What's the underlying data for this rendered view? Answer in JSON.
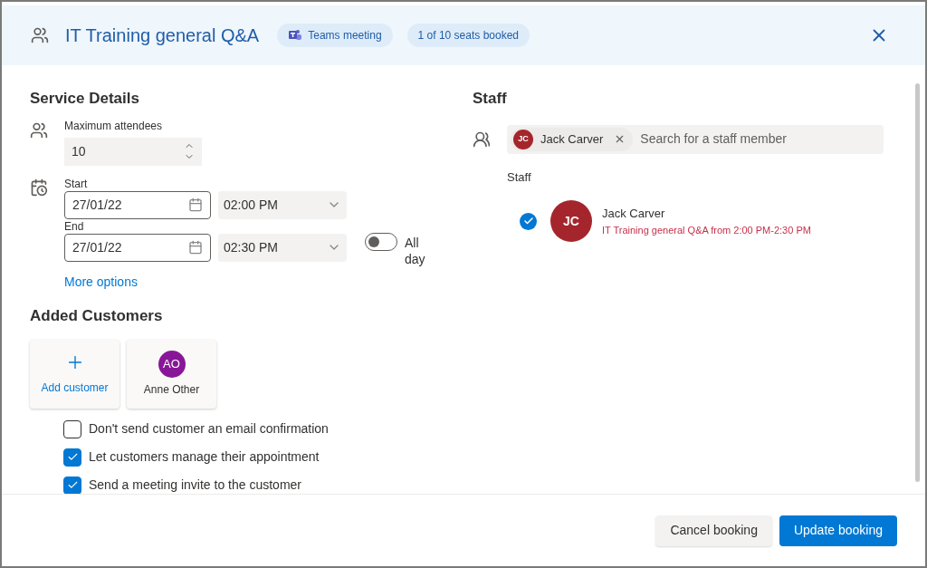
{
  "header": {
    "title": "IT Training general Q&A",
    "badges": [
      {
        "kind": "teams",
        "label": "Teams meeting"
      },
      {
        "kind": "plain",
        "label": "1 of 10 seats booked"
      }
    ]
  },
  "service_details": {
    "heading": "Service Details",
    "max_attendees": {
      "label": "Maximum attendees",
      "value": "10"
    },
    "start": {
      "label": "Start",
      "date": "27/01/22",
      "time": "02:00 PM"
    },
    "end": {
      "label": "End",
      "date": "27/01/22",
      "time": "02:30 PM"
    },
    "all_day": {
      "label": "All day",
      "on": false
    },
    "more_options": "More options"
  },
  "customers": {
    "heading": "Added Customers",
    "add_label": "Add customer",
    "list": [
      {
        "initials": "AO",
        "name": "Anne Other"
      }
    ],
    "options": [
      {
        "label": "Don't send customer an email confirmation",
        "checked": false
      },
      {
        "label": "Let customers manage their appointment",
        "checked": true
      },
      {
        "label": "Send a meeting invite to the customer",
        "checked": true
      }
    ]
  },
  "staff": {
    "heading": "Staff",
    "chips": [
      {
        "initials": "JC",
        "name": "Jack Carver"
      }
    ],
    "search_placeholder": "Search for a staff member",
    "list_heading": "Staff",
    "members": [
      {
        "initials": "JC",
        "name": "Jack Carver",
        "detail": "IT Training general Q&A from 2:00 PM-2:30 PM",
        "checked": true
      }
    ]
  },
  "footer": {
    "buttons": [
      {
        "kind": "secondary",
        "label": "Cancel booking"
      },
      {
        "kind": "primary",
        "label": "Update booking"
      }
    ]
  }
}
